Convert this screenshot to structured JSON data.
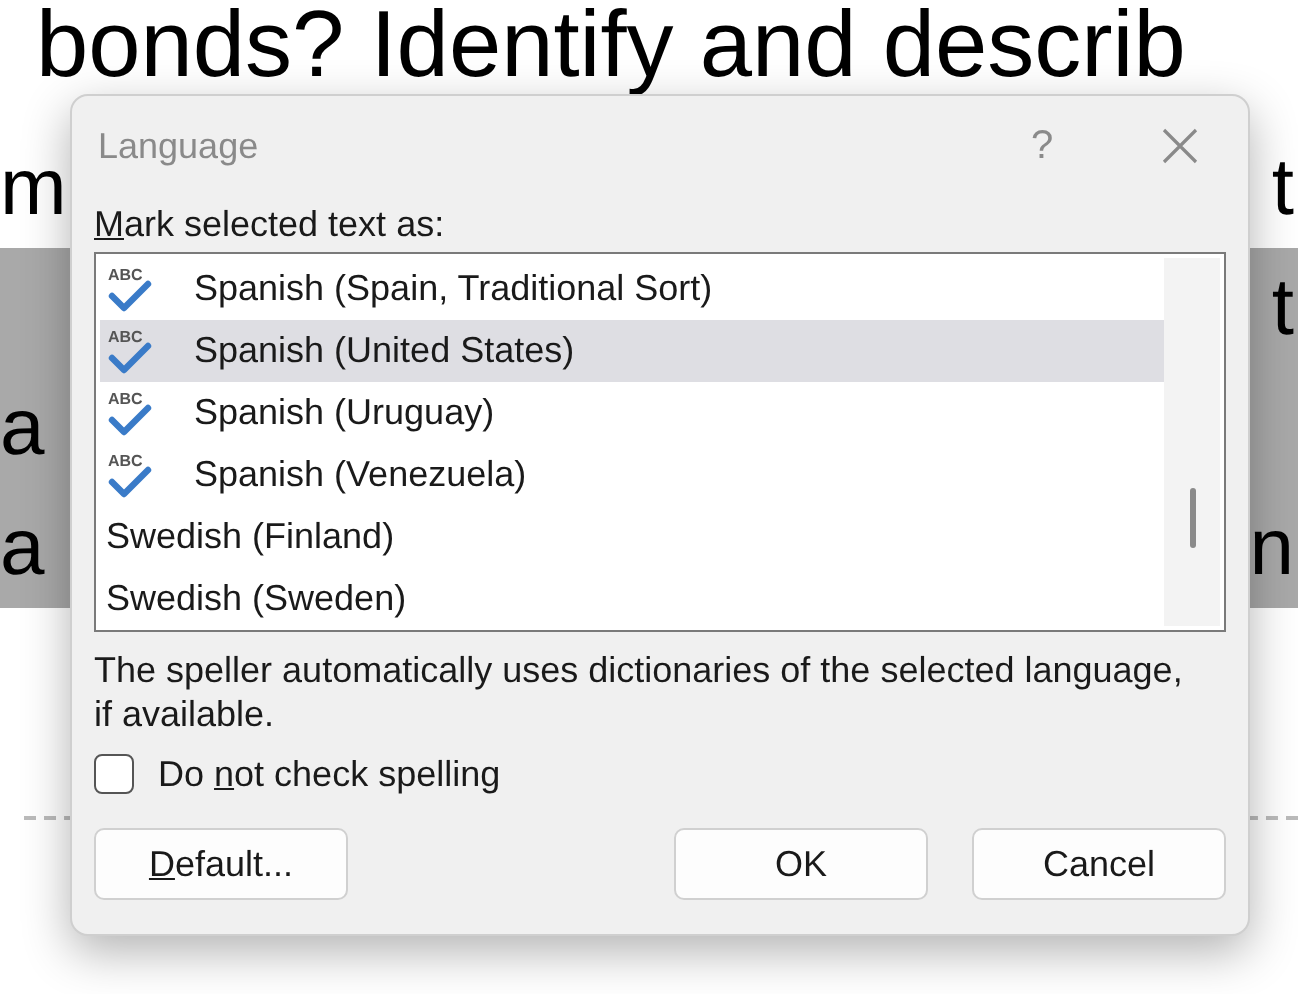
{
  "document": {
    "heading_line": "bonds? Identify and describ",
    "lines": [
      {
        "left": "m",
        "right": "t",
        "highlighted": false
      },
      {
        "right": "t",
        "highlighted": true
      },
      {
        "left": "a",
        "highlighted": true
      },
      {
        "left": "a",
        "right": "n",
        "highlighted": true
      }
    ]
  },
  "dialog": {
    "title": "Language",
    "help": "?",
    "list_label": {
      "key": "M",
      "after": "ark selected text as:"
    },
    "languages": [
      {
        "name": "Spanish (Spain, Traditional Sort)",
        "kind": "spellcheck",
        "icon_text": "ABC",
        "selected": false
      },
      {
        "name": "Spanish (United States)",
        "kind": "spellcheck",
        "icon_text": "ABC",
        "selected": true
      },
      {
        "name": "Spanish (Uruguay)",
        "kind": "spellcheck",
        "icon_text": "ABC",
        "selected": false
      },
      {
        "name": "Spanish (Venezuela)",
        "kind": "spellcheck",
        "icon_text": "ABC",
        "selected": false
      },
      {
        "name": "Swedish (Finland)",
        "kind": "plain",
        "selected": false
      },
      {
        "name": "Swedish (Sweden)",
        "kind": "plain",
        "selected": false
      }
    ],
    "note": "The speller automatically uses dictionaries of the selected language, if available.",
    "no_spellcheck": {
      "label": {
        "before": "Do ",
        "key": "n",
        "after": "ot check spelling"
      },
      "checked": false
    },
    "buttons": [
      {
        "label": {
          "key": "D",
          "after": "efault..."
        },
        "kind": "left"
      },
      {
        "label": {
          "after": "OK"
        },
        "kind": "right"
      },
      {
        "label": {
          "after": "Cancel"
        },
        "kind": "right"
      }
    ]
  }
}
